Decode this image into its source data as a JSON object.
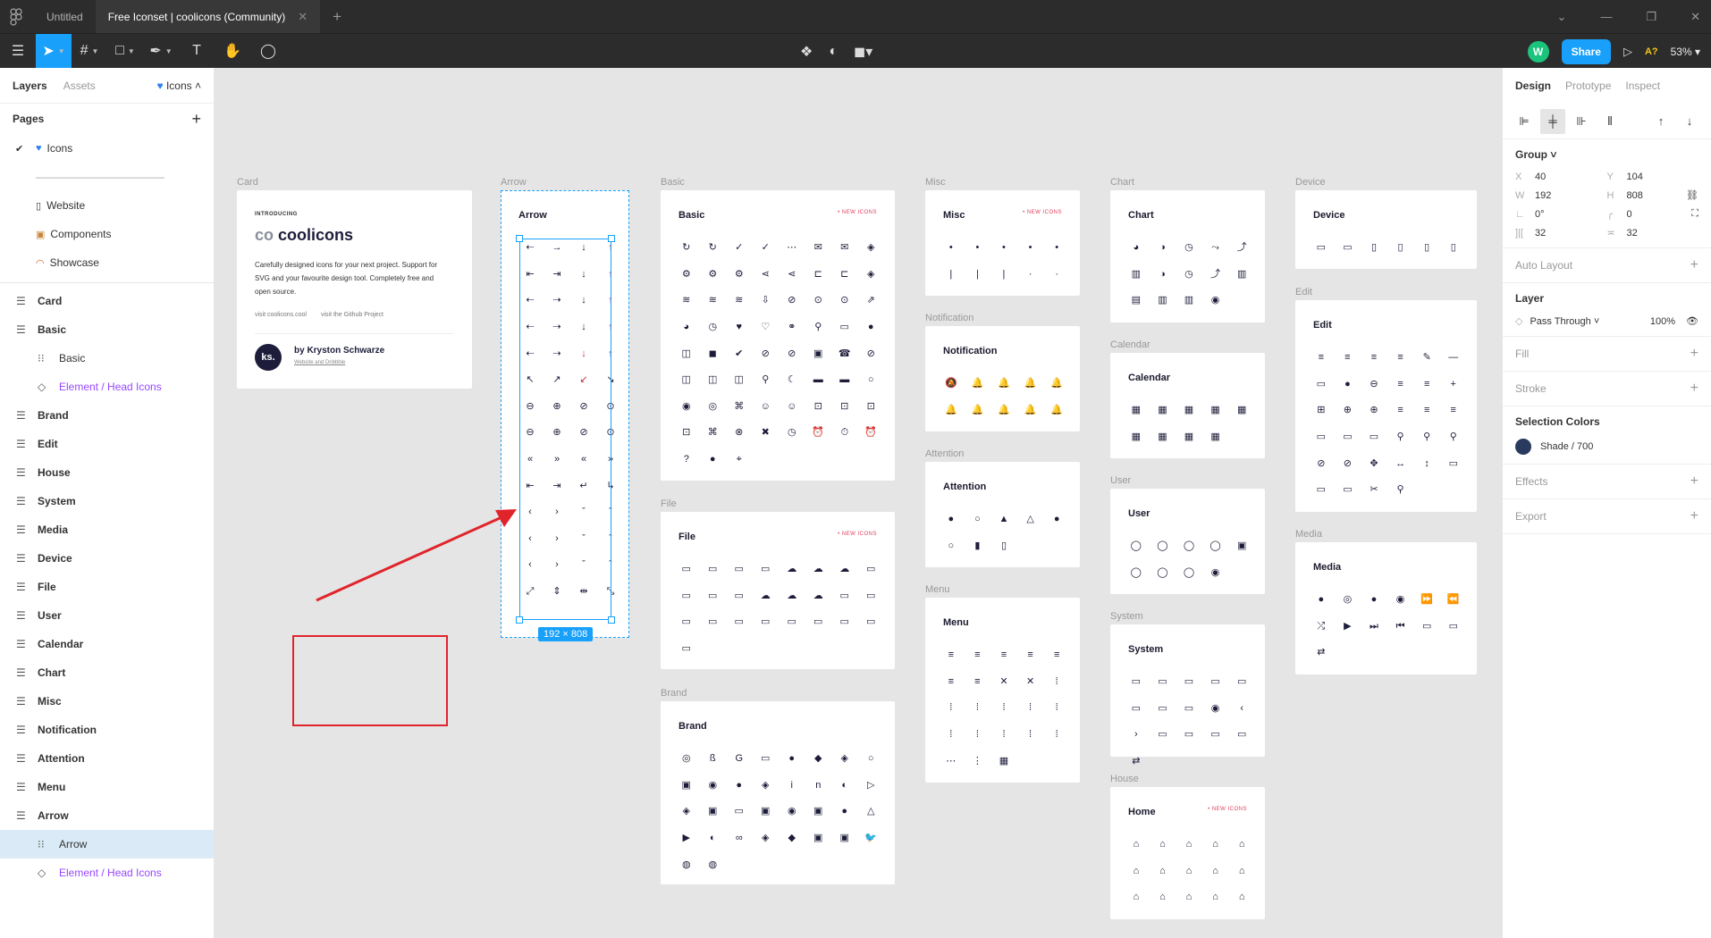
{
  "tabs": [
    {
      "label": "Untitled",
      "active": false
    },
    {
      "label": "Free Iconset | coolicons (Community)",
      "active": true
    }
  ],
  "toolbar": {
    "share_label": "Share",
    "avatar_initial": "W",
    "a11y_label": "A?",
    "zoom": "53%"
  },
  "left_panel": {
    "tab_layers": "Layers",
    "tab_assets": "Assets",
    "current_page": "Icons",
    "pages_heading": "Pages",
    "pages": [
      {
        "label": "Icons",
        "current": true
      },
      {
        "label": "————————————",
        "separator": true
      },
      {
        "label": "Website"
      },
      {
        "label": "Components"
      },
      {
        "label": "Showcase"
      }
    ],
    "layers": [
      {
        "label": "Card",
        "kind": "frame"
      },
      {
        "label": "Basic",
        "kind": "frame"
      },
      {
        "label": "Basic",
        "kind": "group"
      },
      {
        "label": "Element / Head Icons",
        "kind": "component"
      },
      {
        "label": "Brand",
        "kind": "frame"
      },
      {
        "label": "Edit",
        "kind": "frame"
      },
      {
        "label": "House",
        "kind": "frame"
      },
      {
        "label": "System",
        "kind": "frame"
      },
      {
        "label": "Media",
        "kind": "frame"
      },
      {
        "label": "Device",
        "kind": "frame"
      },
      {
        "label": "File",
        "kind": "frame"
      },
      {
        "label": "User",
        "kind": "frame"
      },
      {
        "label": "Calendar",
        "kind": "frame"
      },
      {
        "label": "Chart",
        "kind": "frame"
      },
      {
        "label": "Misc",
        "kind": "frame"
      },
      {
        "label": "Notification",
        "kind": "frame"
      },
      {
        "label": "Attention",
        "kind": "frame"
      },
      {
        "label": "Menu",
        "kind": "frame"
      },
      {
        "label": "Arrow",
        "kind": "frame"
      },
      {
        "label": "Arrow",
        "kind": "group",
        "selected": true
      },
      {
        "label": "Element / Head Icons",
        "kind": "component"
      }
    ]
  },
  "canvas": {
    "new_icons_label": "• NEW ICONS",
    "card": {
      "label": "Card",
      "intro": "INTRODUCING",
      "logo": "coolicons",
      "description": "Carefully designed icons for your next project. Support for SVG and your favourite design tool. Completely free and open source.",
      "link1": "visit coolicons.cool",
      "link2": "visit the Github Project",
      "avatar": "ks.",
      "author": "by Kryston Schwarze",
      "author_sub": "Website and Dribbble"
    },
    "selection_size": "192 × 808",
    "frames": {
      "arrow": "Arrow",
      "basic": "Basic",
      "file": "File",
      "brand": "Brand",
      "misc": "Misc",
      "notification": "Notification",
      "attention": "Attention",
      "menu": "Menu",
      "chart": "Chart",
      "calendar": "Calendar",
      "user": "User",
      "system": "System",
      "house": "House",
      "home": "Home",
      "device": "Device",
      "edit": "Edit",
      "media": "Media"
    }
  },
  "right_panel": {
    "tab_design": "Design",
    "tab_prototype": "Prototype",
    "tab_inspect": "Inspect",
    "x": "40",
    "y": "104",
    "w": "192",
    "h": "808",
    "rotation": "0°",
    "radius": "0",
    "spacing_h": "32",
    "spacing_v": "32",
    "auto_layout": "Auto Layout",
    "layer_heading": "Layer",
    "blend_mode": "Pass Through",
    "opacity": "100%",
    "fill": "Fill",
    "stroke": "Stroke",
    "selection_colors": "Selection Colors",
    "color_name": "Shade / 700",
    "effects": "Effects",
    "export": "Export"
  }
}
